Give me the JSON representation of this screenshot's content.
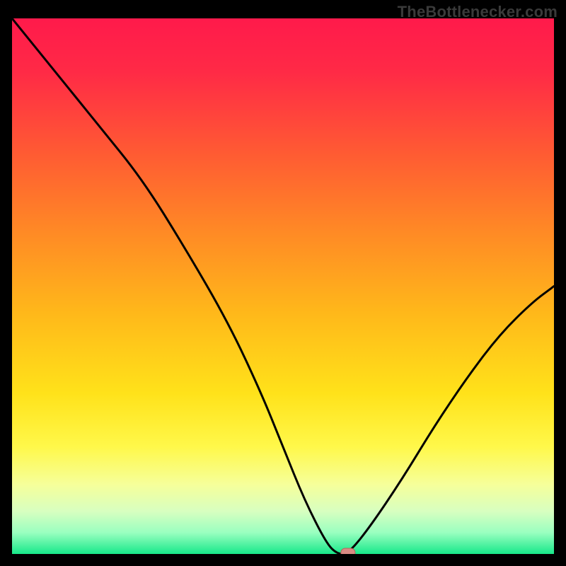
{
  "watermark": "TheBottlenecker.com",
  "colors": {
    "frame_bg": "#000000",
    "curve": "#000000",
    "marker_fill": "#d98b84",
    "marker_stroke": "#b7635b",
    "gradient_stops": [
      {
        "offset": "0%",
        "color": "#ff1a4b"
      },
      {
        "offset": "10%",
        "color": "#ff2a46"
      },
      {
        "offset": "25%",
        "color": "#ff5a33"
      },
      {
        "offset": "40%",
        "color": "#ff8a25"
      },
      {
        "offset": "55%",
        "color": "#ffb81a"
      },
      {
        "offset": "70%",
        "color": "#ffe21a"
      },
      {
        "offset": "80%",
        "color": "#fff84a"
      },
      {
        "offset": "87%",
        "color": "#f6ff9a"
      },
      {
        "offset": "92%",
        "color": "#d8ffc0"
      },
      {
        "offset": "96%",
        "color": "#9affc0"
      },
      {
        "offset": "100%",
        "color": "#17e88a"
      }
    ]
  },
  "chart_data": {
    "type": "line",
    "title": "",
    "xlabel": "",
    "ylabel": "",
    "xlim": [
      0,
      100
    ],
    "ylim": [
      0,
      100
    ],
    "x": [
      0,
      8,
      16,
      24,
      32,
      40,
      46,
      50,
      54,
      58,
      60,
      62,
      66,
      72,
      78,
      84,
      90,
      96,
      100
    ],
    "values": [
      100,
      90,
      80,
      70,
      57,
      43,
      30,
      20,
      10,
      2,
      0,
      0,
      5,
      14,
      24,
      33,
      41,
      47,
      50
    ],
    "marker": {
      "x": 62,
      "y": 0
    }
  }
}
